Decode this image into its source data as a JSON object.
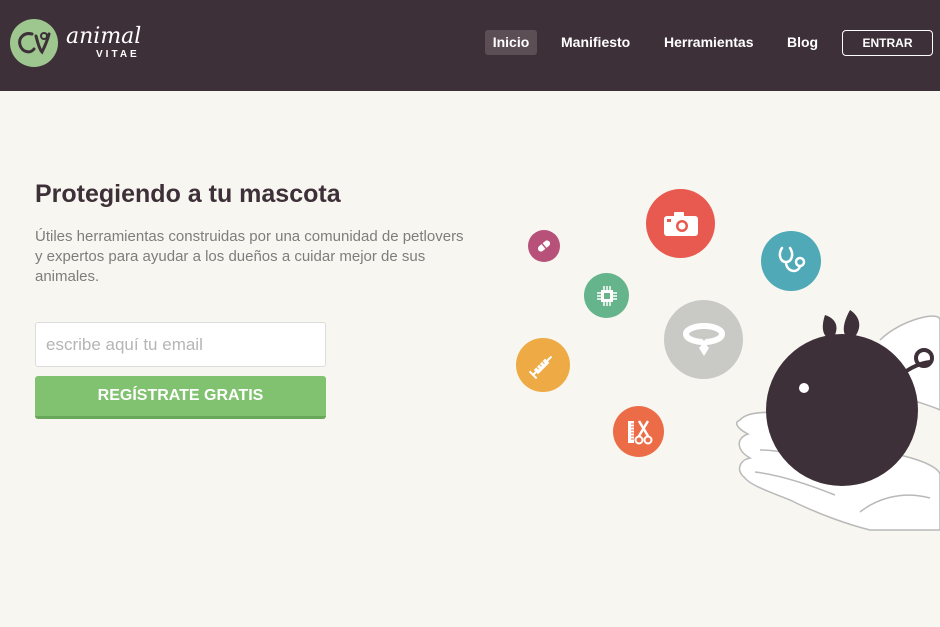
{
  "brand": {
    "name": "animal",
    "sub": "VITAE"
  },
  "nav": {
    "items": [
      {
        "label": "Inicio"
      },
      {
        "label": "Manifiesto"
      },
      {
        "label": "Herramientas"
      },
      {
        "label": "Blog"
      }
    ],
    "login_label": "ENTRAR"
  },
  "hero": {
    "title": "Protegiendo a tu mascota",
    "description": "Útiles herramientas construidas por una comunidad de petlovers y expertos para ayudar a los dueños a cuidar mejor de sus animales.",
    "email_placeholder": "escribe aquí tu email",
    "cta_label": "REGÍSTRATE GRATIS"
  },
  "icons": [
    {
      "name": "pill-icon",
      "color": "#b8517a"
    },
    {
      "name": "camera-icon",
      "color": "#e85a4f"
    },
    {
      "name": "stethoscope-icon",
      "color": "#4fa9b7"
    },
    {
      "name": "microchip-icon",
      "color": "#66b48c"
    },
    {
      "name": "collar-icon",
      "color": "#c9c9c6"
    },
    {
      "name": "syringe-icon",
      "color": "#eeaa45"
    },
    {
      "name": "grooming-icon",
      "color": "#ec6c48"
    }
  ],
  "colors": {
    "header_bg": "#3e3038",
    "accent_green": "#80c26f",
    "page_bg": "#f7f6f0"
  }
}
